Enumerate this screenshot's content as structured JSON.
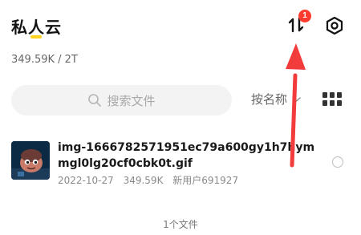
{
  "header": {
    "title": "私人云",
    "transfer_badge": "1",
    "accent_color": "#ffd21f",
    "badge_color": "#ff3b30"
  },
  "storage": {
    "usage": "349.59K / 2T"
  },
  "toolbar": {
    "search_placeholder": "搜索文件",
    "sort_label": "按名称",
    "view_icon": "grid-view-icon"
  },
  "files": [
    {
      "name": "img-1666782571951ec79a600gy1h7hymmgl0lg20cf0cbk0t.gif",
      "date": "2022-10-27",
      "size": "349.59K",
      "owner": "新用户691927"
    }
  ],
  "footer": {
    "file_count": "1个文件"
  },
  "annotation": {
    "arrow_color": "#f23b3b"
  }
}
